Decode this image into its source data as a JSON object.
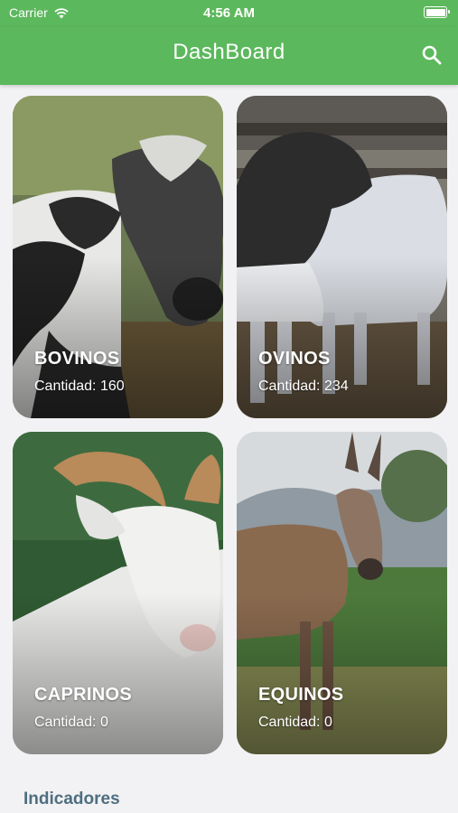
{
  "status": {
    "carrier": "Carrier",
    "time": "4:56 AM"
  },
  "header": {
    "title": "DashBoard"
  },
  "cards": [
    {
      "label": "BOVINOS",
      "count": "Cantidad: 160"
    },
    {
      "label": "OVINOS",
      "count": "Cantidad: 234"
    },
    {
      "label": "CAPRINOS",
      "count": "Cantidad: 0"
    },
    {
      "label": "EQUINOS",
      "count": "Cantidad: 0"
    }
  ],
  "section": {
    "title": "Indicadores"
  },
  "colors": {
    "primary": "#5cb85c",
    "section_text": "#4f6e80",
    "background": "#f2f2f4"
  },
  "icons": {
    "search": "search-icon",
    "wifi": "wifi-icon",
    "battery": "battery-icon"
  }
}
